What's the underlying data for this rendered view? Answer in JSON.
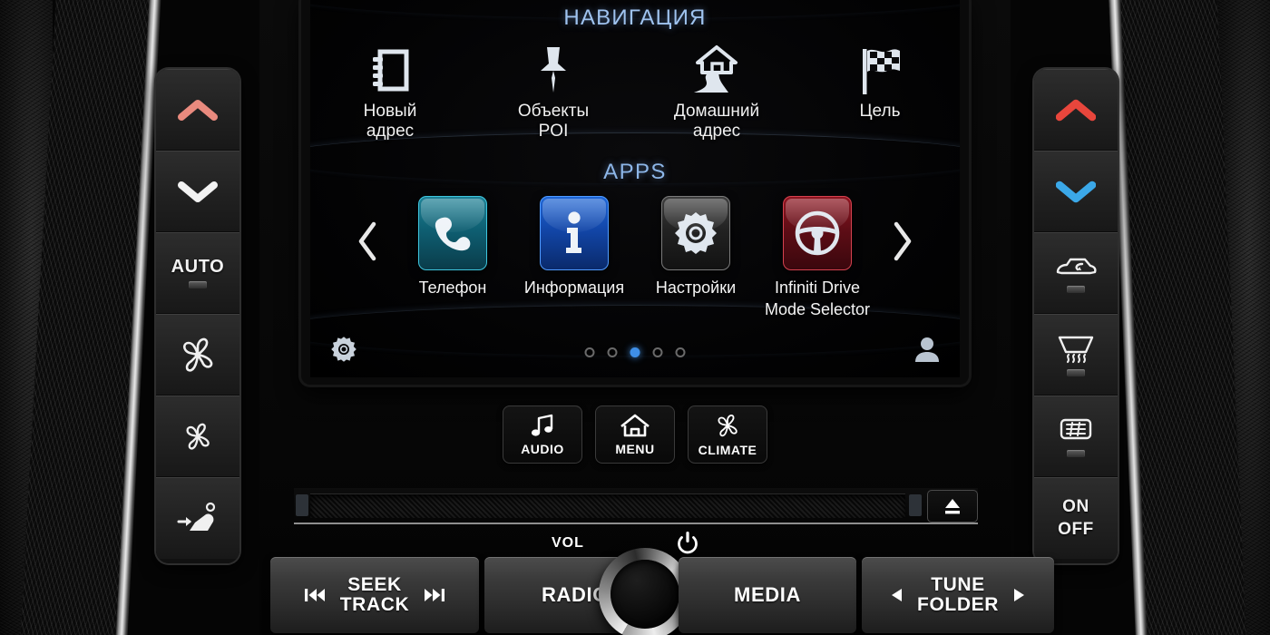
{
  "screen": {
    "navigation": {
      "title": "НАВИГАЦИЯ",
      "items": [
        {
          "label": "Новый\nадрес",
          "label_line1": "Новый",
          "label_line2": "адрес",
          "icon": "address-book-icon"
        },
        {
          "label": "Объекты POI",
          "label_line1": "Объекты",
          "label_line2": "POI",
          "icon": "map-pin-icon"
        },
        {
          "label": "Домашний адрес",
          "label_line1": "Домашний",
          "label_line2": "адрес",
          "icon": "home-road-icon"
        },
        {
          "label": "Цель",
          "label_line1": "Цель",
          "label_line2": "",
          "icon": "checkered-flag-icon"
        }
      ]
    },
    "apps": {
      "title": "APPS",
      "prev_arrow": "‹",
      "next_arrow": "›",
      "items": [
        {
          "label": "Телефон",
          "label_line1": "Телефон",
          "label_line2": "",
          "icon": "phone-icon",
          "color": "#0e5f72"
        },
        {
          "label": "Информация",
          "label_line1": "Информация",
          "label_line2": "",
          "icon": "info-icon",
          "color": "#1246a8"
        },
        {
          "label": "Настройки",
          "label_line1": "Настройки",
          "label_line2": "",
          "icon": "gear-icon",
          "color": "#222222"
        },
        {
          "label": "Infiniti Drive Mode Selector",
          "label_line1": "Infiniti Drive",
          "label_line2": "Mode Selector",
          "icon": "steering-wheel-icon",
          "color": "#5e0d16"
        }
      ]
    },
    "pagination": {
      "total": 5,
      "active_index": 2,
      "active_color": "#3f8fe8"
    },
    "footer": {
      "left_icon": "gear-icon",
      "right_icon": "user-profile-icon"
    }
  },
  "hard_buttons": [
    {
      "label": "AUDIO",
      "icon": "music-note-icon"
    },
    {
      "label": "MENU",
      "icon": "home-icon"
    },
    {
      "label": "CLIMATE",
      "icon": "fan-icon"
    }
  ],
  "media_slot": {
    "eject_icon": "eject-icon"
  },
  "control_row": {
    "vol_label": "VOL",
    "power_icon": "power-icon",
    "seek": {
      "line1": "SEEK",
      "line2": "TRACK",
      "prev_icon": "skip-back-icon",
      "next_icon": "skip-forward-icon"
    },
    "radio": {
      "label": "RADIO"
    },
    "media": {
      "label": "MEDIA"
    },
    "tune": {
      "line1": "TUNE",
      "line2": "FOLDER",
      "prev_icon": "left-triangle-icon",
      "next_icon": "right-triangle-icon"
    },
    "knob": {
      "name": "volume-knob"
    }
  },
  "climate_left": [
    {
      "name": "temp-up",
      "icon": "chevron-up-icon",
      "label": "",
      "icon_color": "#e98a7e",
      "indicator": false
    },
    {
      "name": "temp-down",
      "icon": "chevron-down-icon",
      "label": "",
      "icon_color": "#ffffff",
      "indicator": false
    },
    {
      "name": "auto",
      "icon": "",
      "label": "AUTO",
      "icon_color": "#ffffff",
      "indicator": true
    },
    {
      "name": "fan-increase",
      "icon": "fan-large-icon",
      "label": "",
      "icon_color": "#ffffff",
      "indicator": false
    },
    {
      "name": "fan-decrease",
      "icon": "fan-small-icon",
      "label": "",
      "icon_color": "#ffffff",
      "indicator": false
    },
    {
      "name": "airflow-mode",
      "icon": "seat-airflow-icon",
      "label": "",
      "icon_color": "#ffffff",
      "indicator": false
    }
  ],
  "climate_right": [
    {
      "name": "temp-up",
      "icon": "chevron-up-icon",
      "label": "",
      "icon_color": "#e8463c",
      "indicator": false
    },
    {
      "name": "temp-down",
      "icon": "chevron-down-icon",
      "label": "",
      "icon_color": "#3ba8e8",
      "indicator": false
    },
    {
      "name": "recirculation",
      "icon": "recirculation-car-icon",
      "label": "",
      "icon_color": "#ffffff",
      "indicator": true
    },
    {
      "name": "front-defrost",
      "icon": "front-defrost-icon",
      "label": "",
      "icon_color": "#ffffff",
      "indicator": true
    },
    {
      "name": "rear-defrost",
      "icon": "rear-defrost-icon",
      "label": "",
      "icon_color": "#ffffff",
      "indicator": true
    },
    {
      "name": "climate-power",
      "icon": "",
      "label": "ON\nOFF",
      "label_line1": "ON",
      "label_line2": "OFF",
      "icon_color": "#ffffff",
      "indicator": false
    }
  ]
}
